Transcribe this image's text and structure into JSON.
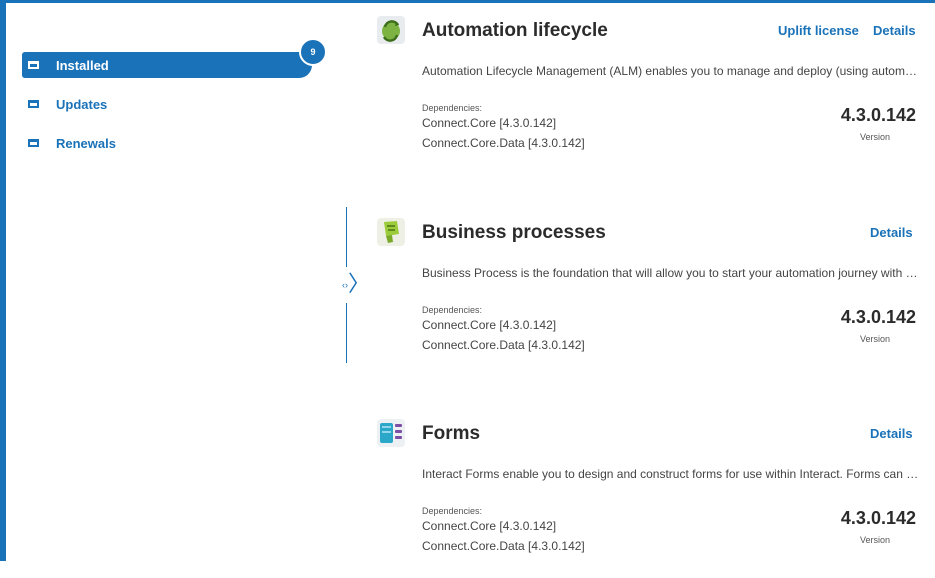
{
  "sidebar": {
    "badge_count": "9",
    "items": [
      {
        "label": "Installed",
        "icon": "folder-icon"
      },
      {
        "label": "Updates",
        "icon": "folder-icon"
      },
      {
        "label": "Renewals",
        "icon": "folder-icon"
      }
    ]
  },
  "collapse_handle": {
    "dots": "‹›",
    "chevron": "〉"
  },
  "apps": [
    {
      "title": "Automation lifecycle",
      "icon": "automation-lifecycle-icon",
      "links": [
        "Uplift license",
        "Details"
      ],
      "description": "Automation Lifecycle Management (ALM) enables you to manage and deploy (using automation) your Blue Prism solutions",
      "dependencies_label": "Dependencies:",
      "dependencies": [
        "Connect.Core [4.3.0.142]",
        "Connect.Core.Data [4.3.0.142]"
      ],
      "version": "4.3.0.142",
      "version_label": "Version"
    },
    {
      "title": "Business processes",
      "icon": "business-processes-icon",
      "links": [
        "Details"
      ],
      "description": "Business Process is the foundation that will allow you to start your automation journey with Blue Prism",
      "dependencies_label": "Dependencies:",
      "dependencies": [
        "Connect.Core [4.3.0.142]",
        "Connect.Core.Data [4.3.0.142]"
      ],
      "version": "4.3.0.142",
      "version_label": "Version"
    },
    {
      "title": "Forms",
      "icon": "forms-icon",
      "links": [
        "Details"
      ],
      "description": "Interact Forms enable you to design and construct forms for use within Interact. Forms can be published",
      "dependencies_label": "Dependencies:",
      "dependencies": [
        "Connect.Core [4.3.0.142]",
        "Connect.Core.Data [4.3.0.142]"
      ],
      "version": "4.3.0.142",
      "version_label": "Version"
    }
  ]
}
